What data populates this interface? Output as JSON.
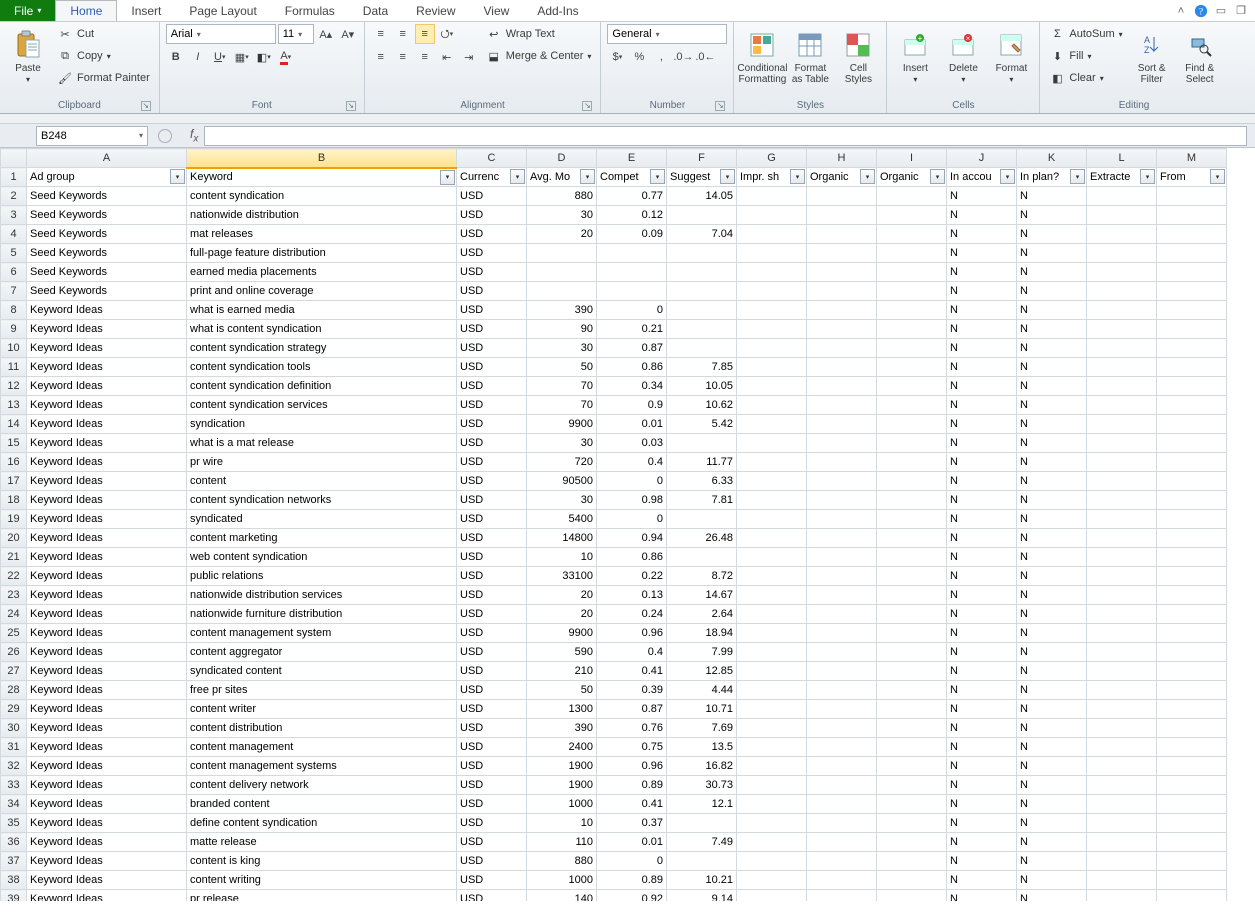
{
  "tabs": {
    "file": "File",
    "list": [
      "Home",
      "Insert",
      "Page Layout",
      "Formulas",
      "Data",
      "Review",
      "View",
      "Add-Ins"
    ],
    "active": "Home"
  },
  "clipboard": {
    "paste": "Paste",
    "cut": "Cut",
    "copy": "Copy",
    "fp": "Format Painter",
    "label": "Clipboard"
  },
  "font": {
    "name": "Arial",
    "size": "11",
    "label": "Font"
  },
  "alignment": {
    "wrap": "Wrap Text",
    "merge": "Merge & Center",
    "label": "Alignment"
  },
  "number": {
    "fmt": "General",
    "label": "Number"
  },
  "styles": {
    "cond": "Conditional\nFormatting",
    "tbl": "Format\nas Table",
    "cell": "Cell\nStyles",
    "label": "Styles"
  },
  "cells": {
    "ins": "Insert",
    "del": "Delete",
    "fmt": "Format",
    "label": "Cells"
  },
  "editing": {
    "sum": "AutoSum",
    "fill": "Fill",
    "clear": "Clear",
    "sort": "Sort &\nFilter",
    "find": "Find &\nSelect",
    "label": "Editing"
  },
  "namebox": "B248",
  "columns": [
    "A",
    "B",
    "C",
    "D",
    "E",
    "F",
    "G",
    "H",
    "I",
    "J",
    "K",
    "L",
    "M"
  ],
  "headers": [
    "Ad group",
    "Keyword",
    "Currenc",
    "Avg. Mo",
    "Compet",
    "Suggest",
    "Impr. sh",
    "Organic",
    "Organic",
    "In accou",
    "In plan?",
    "Extracte",
    "From"
  ],
  "rows": [
    {
      "n": 2,
      "a": "Seed Keywords",
      "b": "content syndication",
      "c": "USD",
      "d": "880",
      "e": "0.77",
      "f": "14.05",
      "j": "N",
      "k": "N"
    },
    {
      "n": 3,
      "a": "Seed Keywords",
      "b": "nationwide distribution",
      "c": "USD",
      "d": "30",
      "e": "0.12",
      "f": "",
      "j": "N",
      "k": "N"
    },
    {
      "n": 4,
      "a": "Seed Keywords",
      "b": "mat releases",
      "c": "USD",
      "d": "20",
      "e": "0.09",
      "f": "7.04",
      "j": "N",
      "k": "N"
    },
    {
      "n": 5,
      "a": "Seed Keywords",
      "b": "full-page feature distribution",
      "c": "USD",
      "d": "",
      "e": "",
      "f": "",
      "j": "N",
      "k": "N"
    },
    {
      "n": 6,
      "a": "Seed Keywords",
      "b": "earned media placements",
      "c": "USD",
      "d": "",
      "e": "",
      "f": "",
      "j": "N",
      "k": "N"
    },
    {
      "n": 7,
      "a": "Seed Keywords",
      "b": "print and online coverage",
      "c": "USD",
      "d": "",
      "e": "",
      "f": "",
      "j": "N",
      "k": "N"
    },
    {
      "n": 8,
      "a": "Keyword Ideas",
      "b": "what is earned media",
      "c": "USD",
      "d": "390",
      "e": "0",
      "f": "",
      "j": "N",
      "k": "N"
    },
    {
      "n": 9,
      "a": "Keyword Ideas",
      "b": "what is content syndication",
      "c": "USD",
      "d": "90",
      "e": "0.21",
      "f": "",
      "j": "N",
      "k": "N"
    },
    {
      "n": 10,
      "a": "Keyword Ideas",
      "b": "content syndication strategy",
      "c": "USD",
      "d": "30",
      "e": "0.87",
      "f": "",
      "j": "N",
      "k": "N"
    },
    {
      "n": 11,
      "a": "Keyword Ideas",
      "b": "content syndication tools",
      "c": "USD",
      "d": "50",
      "e": "0.86",
      "f": "7.85",
      "j": "N",
      "k": "N"
    },
    {
      "n": 12,
      "a": "Keyword Ideas",
      "b": "content syndication definition",
      "c": "USD",
      "d": "70",
      "e": "0.34",
      "f": "10.05",
      "j": "N",
      "k": "N"
    },
    {
      "n": 13,
      "a": "Keyword Ideas",
      "b": "content syndication services",
      "c": "USD",
      "d": "70",
      "e": "0.9",
      "f": "10.62",
      "j": "N",
      "k": "N"
    },
    {
      "n": 14,
      "a": "Keyword Ideas",
      "b": "syndication",
      "c": "USD",
      "d": "9900",
      "e": "0.01",
      "f": "5.42",
      "j": "N",
      "k": "N"
    },
    {
      "n": 15,
      "a": "Keyword Ideas",
      "b": "what is a mat release",
      "c": "USD",
      "d": "30",
      "e": "0.03",
      "f": "",
      "j": "N",
      "k": "N"
    },
    {
      "n": 16,
      "a": "Keyword Ideas",
      "b": "pr wire",
      "c": "USD",
      "d": "720",
      "e": "0.4",
      "f": "11.77",
      "j": "N",
      "k": "N"
    },
    {
      "n": 17,
      "a": "Keyword Ideas",
      "b": "content",
      "c": "USD",
      "d": "90500",
      "e": "0",
      "f": "6.33",
      "j": "N",
      "k": "N"
    },
    {
      "n": 18,
      "a": "Keyword Ideas",
      "b": "content syndication networks",
      "c": "USD",
      "d": "30",
      "e": "0.98",
      "f": "7.81",
      "j": "N",
      "k": "N"
    },
    {
      "n": 19,
      "a": "Keyword Ideas",
      "b": "syndicated",
      "c": "USD",
      "d": "5400",
      "e": "0",
      "f": "",
      "j": "N",
      "k": "N"
    },
    {
      "n": 20,
      "a": "Keyword Ideas",
      "b": "content marketing",
      "c": "USD",
      "d": "14800",
      "e": "0.94",
      "f": "26.48",
      "j": "N",
      "k": "N"
    },
    {
      "n": 21,
      "a": "Keyword Ideas",
      "b": "web content syndication",
      "c": "USD",
      "d": "10",
      "e": "0.86",
      "f": "",
      "j": "N",
      "k": "N"
    },
    {
      "n": 22,
      "a": "Keyword Ideas",
      "b": "public relations",
      "c": "USD",
      "d": "33100",
      "e": "0.22",
      "f": "8.72",
      "j": "N",
      "k": "N"
    },
    {
      "n": 23,
      "a": "Keyword Ideas",
      "b": "nationwide distribution services",
      "c": "USD",
      "d": "20",
      "e": "0.13",
      "f": "14.67",
      "j": "N",
      "k": "N"
    },
    {
      "n": 24,
      "a": "Keyword Ideas",
      "b": "nationwide furniture distribution",
      "c": "USD",
      "d": "20",
      "e": "0.24",
      "f": "2.64",
      "j": "N",
      "k": "N"
    },
    {
      "n": 25,
      "a": "Keyword Ideas",
      "b": "content management system",
      "c": "USD",
      "d": "9900",
      "e": "0.96",
      "f": "18.94",
      "j": "N",
      "k": "N"
    },
    {
      "n": 26,
      "a": "Keyword Ideas",
      "b": "content aggregator",
      "c": "USD",
      "d": "590",
      "e": "0.4",
      "f": "7.99",
      "j": "N",
      "k": "N"
    },
    {
      "n": 27,
      "a": "Keyword Ideas",
      "b": "syndicated content",
      "c": "USD",
      "d": "210",
      "e": "0.41",
      "f": "12.85",
      "j": "N",
      "k": "N"
    },
    {
      "n": 28,
      "a": "Keyword Ideas",
      "b": "free pr sites",
      "c": "USD",
      "d": "50",
      "e": "0.39",
      "f": "4.44",
      "j": "N",
      "k": "N"
    },
    {
      "n": 29,
      "a": "Keyword Ideas",
      "b": "content writer",
      "c": "USD",
      "d": "1300",
      "e": "0.87",
      "f": "10.71",
      "j": "N",
      "k": "N"
    },
    {
      "n": 30,
      "a": "Keyword Ideas",
      "b": "content distribution",
      "c": "USD",
      "d": "390",
      "e": "0.76",
      "f": "7.69",
      "j": "N",
      "k": "N"
    },
    {
      "n": 31,
      "a": "Keyword Ideas",
      "b": "content management",
      "c": "USD",
      "d": "2400",
      "e": "0.75",
      "f": "13.5",
      "j": "N",
      "k": "N"
    },
    {
      "n": 32,
      "a": "Keyword Ideas",
      "b": "content management systems",
      "c": "USD",
      "d": "1900",
      "e": "0.96",
      "f": "16.82",
      "j": "N",
      "k": "N"
    },
    {
      "n": 33,
      "a": "Keyword Ideas",
      "b": "content delivery network",
      "c": "USD",
      "d": "1900",
      "e": "0.89",
      "f": "30.73",
      "j": "N",
      "k": "N"
    },
    {
      "n": 34,
      "a": "Keyword Ideas",
      "b": "branded content",
      "c": "USD",
      "d": "1000",
      "e": "0.41",
      "f": "12.1",
      "j": "N",
      "k": "N"
    },
    {
      "n": 35,
      "a": "Keyword Ideas",
      "b": "define content syndication",
      "c": "USD",
      "d": "10",
      "e": "0.37",
      "f": "",
      "j": "N",
      "k": "N"
    },
    {
      "n": 36,
      "a": "Keyword Ideas",
      "b": "matte release",
      "c": "USD",
      "d": "110",
      "e": "0.01",
      "f": "7.49",
      "j": "N",
      "k": "N"
    },
    {
      "n": 37,
      "a": "Keyword Ideas",
      "b": "content is king",
      "c": "USD",
      "d": "880",
      "e": "0",
      "f": "",
      "j": "N",
      "k": "N"
    },
    {
      "n": 38,
      "a": "Keyword Ideas",
      "b": "content writing",
      "c": "USD",
      "d": "1000",
      "e": "0.89",
      "f": "10.21",
      "j": "N",
      "k": "N"
    },
    {
      "n": 39,
      "a": "Keyword Ideas",
      "b": "pr release",
      "c": "USD",
      "d": "140",
      "e": "0.92",
      "f": "9.14",
      "j": "N",
      "k": "N"
    }
  ]
}
